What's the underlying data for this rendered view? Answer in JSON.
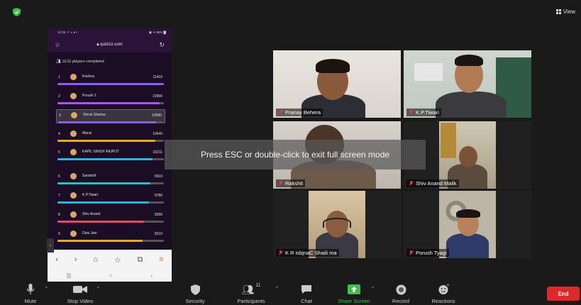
{
  "topbar": {
    "view_label": "View"
  },
  "phone": {
    "status_left": "12:35 ↗ ↘ ● •",
    "status_right": "▣ ✦ 86% ▇",
    "url": "quizizz.com",
    "players_completed": "11/11 players completed",
    "leaderboard": [
      {
        "rank": "1",
        "name": "Krishna",
        "score": "11410",
        "color": "#8b5cf6",
        "fill": 1.0,
        "highlight": false
      },
      {
        "rank": "2",
        "name": "Porush 1",
        "score": "10990",
        "color": "#a855f7",
        "fill": 0.96,
        "highlight": false
      },
      {
        "rank": "3",
        "name": "Shruti Sharma",
        "score": "10590",
        "color": "#8b5cf6",
        "fill": 0.93,
        "highlight": true
      },
      {
        "rank": "4",
        "name": "Mansi",
        "score": "10540",
        "color": "#f5a524",
        "fill": 0.92,
        "highlight": false
      },
      {
        "rank": "5",
        "name": "KAPIL SINGH RAJPUT",
        "score": "10211",
        "color": "#2fb5d8",
        "fill": 0.89,
        "highlight": false
      },
      {
        "rank": "6",
        "name": "Sanskriti",
        "score": "9910",
        "color": "#27c1c9",
        "fill": 0.87,
        "highlight": false
      },
      {
        "rank": "7",
        "name": "K.P.Tiwari",
        "score": "9780",
        "color": "#2fb5d8",
        "fill": 0.86,
        "highlight": false
      },
      {
        "rank": "8",
        "name": "Shiv Anand",
        "score": "9290",
        "color": "#e94a65",
        "fill": 0.81,
        "highlight": false
      },
      {
        "rank": "9",
        "name": "Diva Jain",
        "score": "9210",
        "color": "#f5a524",
        "fill": 0.8,
        "highlight": false
      }
    ]
  },
  "participants": [
    {
      "name": "Pranay Behera"
    },
    {
      "name": "K.P.Tiwari"
    },
    {
      "name": "Rakshit"
    },
    {
      "name": "Shiv Anand Malik"
    },
    {
      "name": "K R isbjnaC Shaili ma"
    },
    {
      "name": "Porush Tyagi"
    }
  ],
  "toast": "Press ESC or double-click to exit full screen mode",
  "toolbar": {
    "mute": "Mute",
    "stop_video": "Stop Video",
    "security": "Security",
    "participants": "Participants",
    "participants_count": "11",
    "chat": "Chat",
    "share_screen": "Share Screen",
    "record": "Record",
    "reactions": "Reactions",
    "end": "End"
  },
  "colors": {
    "share_green": "#3fbf4a",
    "end_red": "#e02828",
    "shield_green": "#3fbf4a"
  }
}
